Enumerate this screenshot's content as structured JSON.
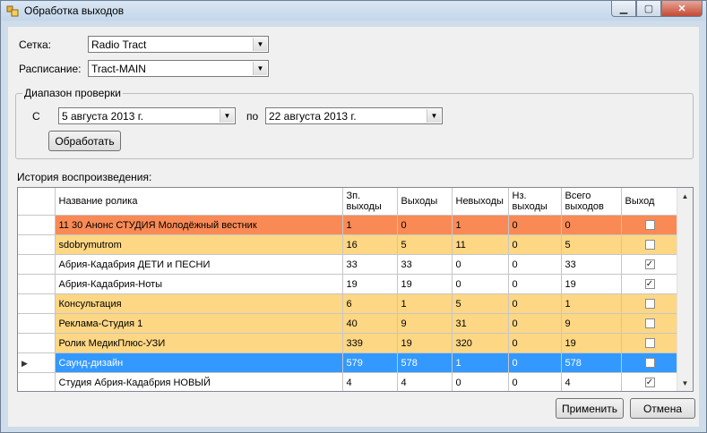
{
  "window": {
    "title": "Обработка выходов"
  },
  "setka": {
    "label": "Сетка:",
    "value": "Radio Tract"
  },
  "raspisanie": {
    "label": "Расписание:",
    "value": "Tract-MAIN"
  },
  "range": {
    "group_title": "Диапазон проверки",
    "from_label": "С",
    "from_value": "5  августа  2013 г.",
    "to_label": "по",
    "to_value": "22  августа  2013 г.",
    "process_button": "Обработать"
  },
  "history": {
    "label": "История воспроизведения:",
    "columns": [
      "Название ролика",
      "Зп. выходы",
      "Выходы",
      "Невыходы",
      "Нз. выходы",
      "Всего выходов",
      "Выход"
    ],
    "rows": [
      {
        "name": "11 30 Анонс СТУДИЯ Молодёжный вестник",
        "zp": "1",
        "out": "0",
        "notout": "1",
        "nz": "0",
        "total": "0",
        "checked": false,
        "style": "orange"
      },
      {
        "name": "sdobrymutrom",
        "zp": "16",
        "out": "5",
        "notout": "11",
        "nz": "0",
        "total": "5",
        "checked": false,
        "style": "yellow"
      },
      {
        "name": "Абрия-Кадабрия ДЕТИ и ПЕСНИ",
        "zp": "33",
        "out": "33",
        "notout": "0",
        "nz": "0",
        "total": "33",
        "checked": true,
        "style": "white"
      },
      {
        "name": "Абрия-Кадабрия-Ноты",
        "zp": "19",
        "out": "19",
        "notout": "0",
        "nz": "0",
        "total": "19",
        "checked": true,
        "style": "white"
      },
      {
        "name": "Консультация",
        "zp": "6",
        "out": "1",
        "notout": "5",
        "nz": "0",
        "total": "1",
        "checked": false,
        "style": "yellow"
      },
      {
        "name": "Реклама-Студия 1",
        "zp": "40",
        "out": "9",
        "notout": "31",
        "nz": "0",
        "total": "9",
        "checked": false,
        "style": "yellow"
      },
      {
        "name": "Ролик МедикПлюс-УЗИ",
        "zp": "339",
        "out": "19",
        "notout": "320",
        "nz": "0",
        "total": "19",
        "checked": false,
        "style": "yellow"
      },
      {
        "name": "Саунд-дизайн",
        "zp": "579",
        "out": "578",
        "notout": "1",
        "nz": "0",
        "total": "578",
        "checked": false,
        "style": "selected"
      },
      {
        "name": "Студия Абрия-Кадабрия НОВЫЙ",
        "zp": "4",
        "out": "4",
        "notout": "0",
        "nz": "0",
        "total": "4",
        "checked": true,
        "style": "white"
      }
    ]
  },
  "buttons": {
    "apply": "Применить",
    "cancel": "Отмена"
  },
  "colors": {
    "orange_row": "#fa8a55",
    "yellow_row": "#fdd784",
    "selected_row": "#3399ff"
  }
}
